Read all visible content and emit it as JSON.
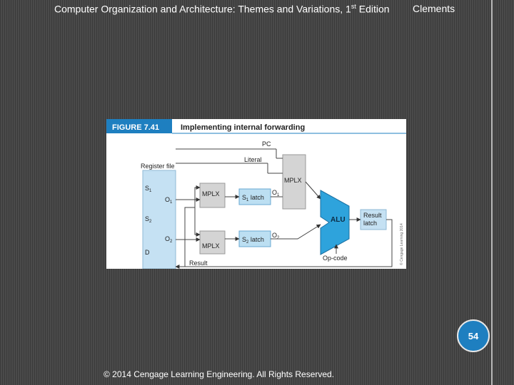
{
  "header": {
    "title_main": "Computer Organization and Architecture: Themes and Variations, 1",
    "title_sup": "st",
    "title_tail": " Edition",
    "author": "Clements"
  },
  "figure": {
    "tag": "FIGURE 7.41",
    "caption": "Implementing internal forwarding",
    "labels": {
      "pc": "PC",
      "literal": "Literal",
      "register_file": "Register file",
      "s1": "S",
      "s1_sub": "1",
      "s2": "S",
      "s2_sub": "2",
      "d": "D",
      "o1": "O",
      "o1_sub": "1",
      "o2": "O",
      "o2_sub": "2",
      "mplx_top": "MPLX",
      "mplx_upper": "MPLX",
      "mplx_lower": "MPLX",
      "s1_latch": "S",
      "s1_latch_sub": "1",
      "s1_latch_tail": " latch",
      "s2_latch": "S",
      "s2_latch_sub": "2",
      "s2_latch_tail": " latch",
      "o1_out": "O",
      "o1_out_sub": "1",
      "o2_out": "O",
      "o2_out_sub": "2",
      "alu": "ALU",
      "result_latch_1": "Result",
      "result_latch_2": "latch",
      "op_code": "Op-code",
      "result": "Result",
      "credit": "© Cengage Learning 2014"
    },
    "colors": {
      "header_bg": "#1e7fc0",
      "register_fill": "#c5e1f3",
      "mplx_fill": "#d4d4d4",
      "latch_fill": "#bcdff2",
      "alu_fill": "#2ea3dc",
      "result_latch_fill": "#c5e1f3"
    }
  },
  "page_number": "54",
  "copyright": "© 2014 Cengage Learning Engineering. All Rights Reserved."
}
